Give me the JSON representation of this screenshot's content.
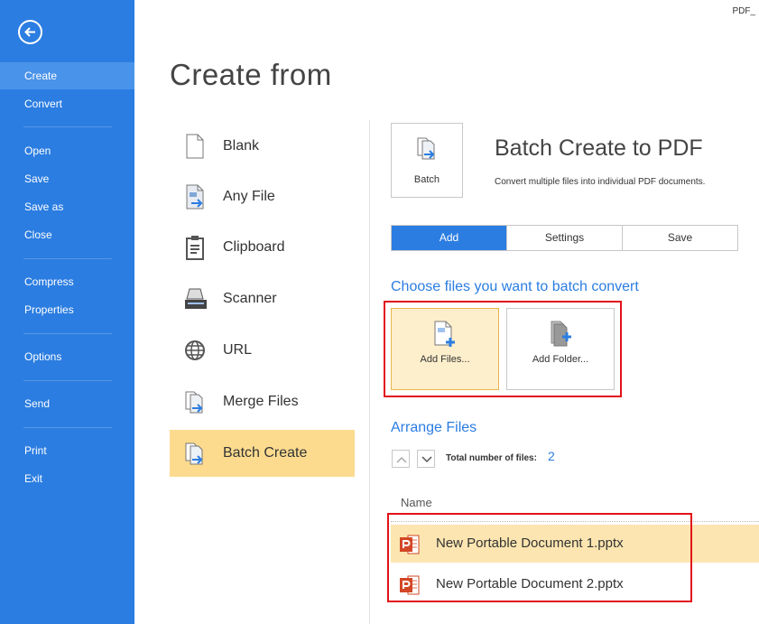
{
  "window": {
    "top_right_label": "PDF_"
  },
  "sidebar": {
    "back_icon": "arrow-left-circle-icon",
    "items": [
      {
        "label": "Create",
        "active": true
      },
      {
        "label": "Convert"
      },
      {
        "label": "Open"
      },
      {
        "label": "Save"
      },
      {
        "label": "Save as"
      },
      {
        "label": "Close"
      },
      {
        "label": "Compress"
      },
      {
        "label": "Properties"
      },
      {
        "label": "Options"
      },
      {
        "label": "Send"
      },
      {
        "label": "Print"
      },
      {
        "label": "Exit"
      }
    ]
  },
  "page": {
    "title": "Create from"
  },
  "sources": [
    {
      "label": "Blank",
      "icon": "blank-page-icon"
    },
    {
      "label": "Any File",
      "icon": "file-arrow-icon"
    },
    {
      "label": "Clipboard",
      "icon": "clipboard-icon"
    },
    {
      "label": "Scanner",
      "icon": "scanner-icon"
    },
    {
      "label": "URL",
      "icon": "globe-icon"
    },
    {
      "label": "Merge Files",
      "icon": "merge-files-icon"
    },
    {
      "label": "Batch Create",
      "icon": "batch-icon",
      "active": true
    }
  ],
  "panel": {
    "tile_label": "Batch",
    "title": "Batch Create to PDF",
    "description": "Convert multiple files into individual PDF documents.",
    "tabs": [
      {
        "label": "Add",
        "active": true
      },
      {
        "label": "Settings"
      },
      {
        "label": "Save"
      }
    ],
    "choose_heading": "Choose files you want to batch convert",
    "add_files_label": "Add Files...",
    "add_folder_label": "Add Folder...",
    "arrange_heading": "Arrange Files",
    "total_label": "Total number of files:",
    "total_count": "2",
    "column_name": "Name",
    "files": [
      {
        "name": "New Portable Document 1.pptx",
        "icon": "powerpoint-icon"
      },
      {
        "name": "New Portable Document 2.pptx",
        "icon": "powerpoint-icon"
      }
    ]
  },
  "colors": {
    "accent": "#2b7de1",
    "selection": "#fcdb8f",
    "highlight_box": "#e2121a"
  }
}
